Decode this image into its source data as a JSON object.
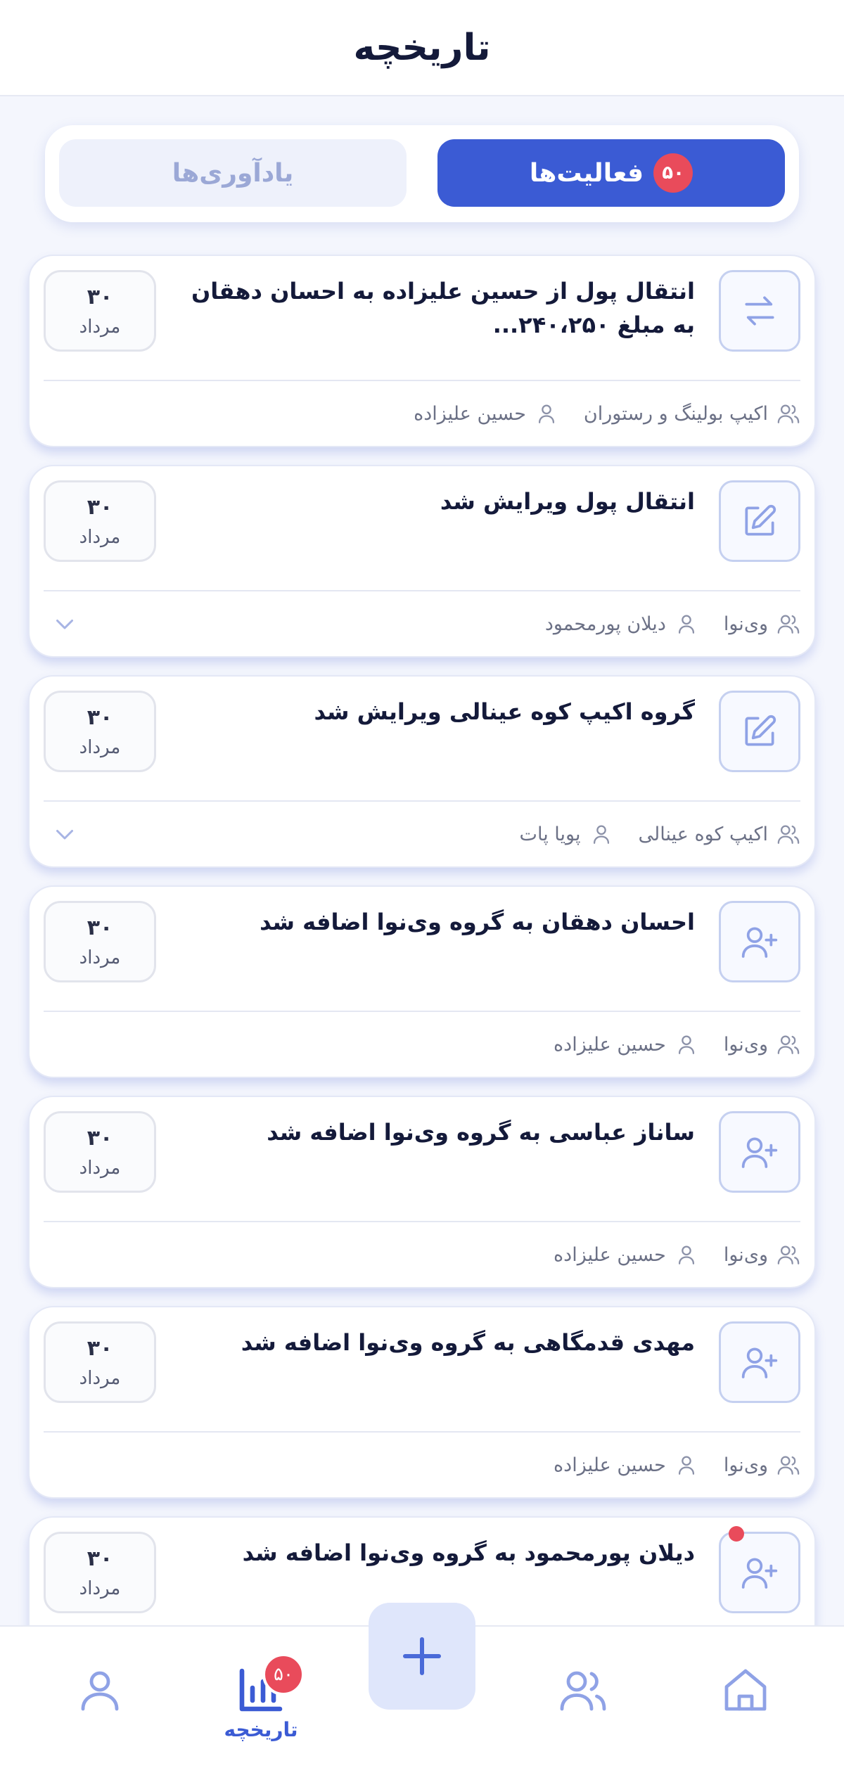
{
  "header": {
    "title": "تاریخچه"
  },
  "tabs": {
    "activities": {
      "label": "فعالیت‌ها",
      "badge": "۵۰"
    },
    "reminders": {
      "label": "یادآوری‌ها"
    }
  },
  "activities": [
    {
      "icon": "transfer-icon",
      "title": "انتقال پول از حسین علیزاده به احسان دهقان به مبلغ ۲۴۰،۲۵۰...",
      "day": "۳۰",
      "month": "مرداد",
      "group": "اکیپ بولینگ و رستوران",
      "user": "حسین علیزاده",
      "expandable": false
    },
    {
      "icon": "edit-icon",
      "title": "انتقال پول ویرایش شد",
      "day": "۳۰",
      "month": "مرداد",
      "group": "وی‌نوا",
      "user": "دیلان پورمحمود",
      "expandable": true
    },
    {
      "icon": "edit-icon",
      "title": "گروه اکیپ کوه عینالی ویرایش شد",
      "day": "۳۰",
      "month": "مرداد",
      "group": "اکیپ کوه عینالی",
      "user": "پویا پات",
      "expandable": true
    },
    {
      "icon": "user-plus-icon",
      "title": "احسان دهقان به گروه وی‌نوا اضافه شد",
      "day": "۳۰",
      "month": "مرداد",
      "group": "وی‌نوا",
      "user": "حسین علیزاده",
      "expandable": false
    },
    {
      "icon": "user-plus-icon",
      "title": "ساناز عباسی به گروه وی‌نوا اضافه شد",
      "day": "۳۰",
      "month": "مرداد",
      "group": "وی‌نوا",
      "user": "حسین علیزاده",
      "expandable": false
    },
    {
      "icon": "user-plus-icon",
      "title": "مهدی قدمگاهی به گروه وی‌نوا اضافه شد",
      "day": "۳۰",
      "month": "مرداد",
      "group": "وی‌نوا",
      "user": "حسین علیزاده",
      "expandable": false
    },
    {
      "icon": "user-plus-icon",
      "title": "دیلان پورمحمود به گروه وی‌نوا اضافه شد",
      "day": "۳۰",
      "month": "مرداد",
      "group": "",
      "user": "",
      "expandable": false,
      "unread": true
    }
  ],
  "bottom_nav": {
    "history": {
      "label": "تاریخچه",
      "badge": "۵۰"
    }
  },
  "colors": {
    "primary": "#3b5bd4",
    "badge": "#e94b5b",
    "icon": "#8fa2e6",
    "background": "#f4f6fd"
  }
}
